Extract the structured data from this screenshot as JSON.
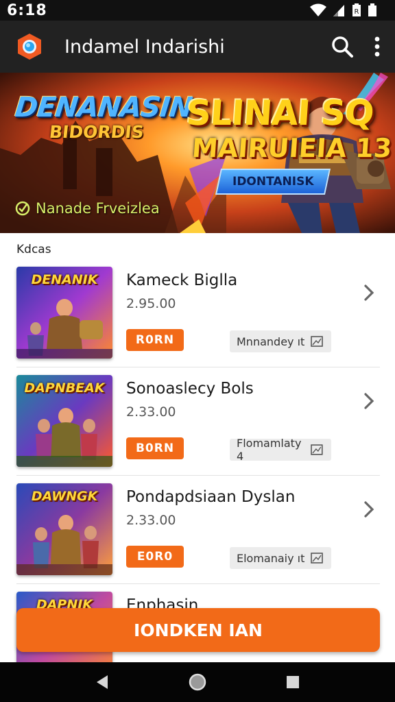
{
  "status_bar": {
    "time": "6:18"
  },
  "app_bar": {
    "title": "Indamel Indarishi",
    "icons": [
      "app-logo",
      "search-icon",
      "more-vert-icon"
    ]
  },
  "banner": {
    "title_line1": "DENANASIN",
    "title_line1b": "BIDORDIS",
    "title_line2": "SLINAI SQ",
    "title_line2b": "MAIRUIEIA 13",
    "ribbon": "IDONTANISK",
    "tag": "Nanade Frveizlea"
  },
  "section": {
    "label": "Kdcas"
  },
  "items": [
    {
      "thumb_title": "DENANIK",
      "name": "Kameck Biglla",
      "price": "2.95.00",
      "button": "R0RN",
      "tag": "Mnnandey ıt"
    },
    {
      "thumb_title": "DAPNBEAK",
      "name": "Sonoaslecy Bols",
      "price": "2.33.00",
      "button": "B0RN",
      "tag": "Flomamlaty 4"
    },
    {
      "thumb_title": "DAWNGK",
      "name": "Pondapdsiaan Dyslan",
      "price": "2.33.00",
      "button": "E0R0",
      "tag": "Elomanaiy ıt"
    },
    {
      "thumb_title": "DAPNIK",
      "name": "Enphasin"
    }
  ],
  "cta": {
    "label": "IONDKEN IAN"
  },
  "colors": {
    "accent": "#f26a18",
    "app_bar": "#222222",
    "status_bar": "#111111"
  }
}
